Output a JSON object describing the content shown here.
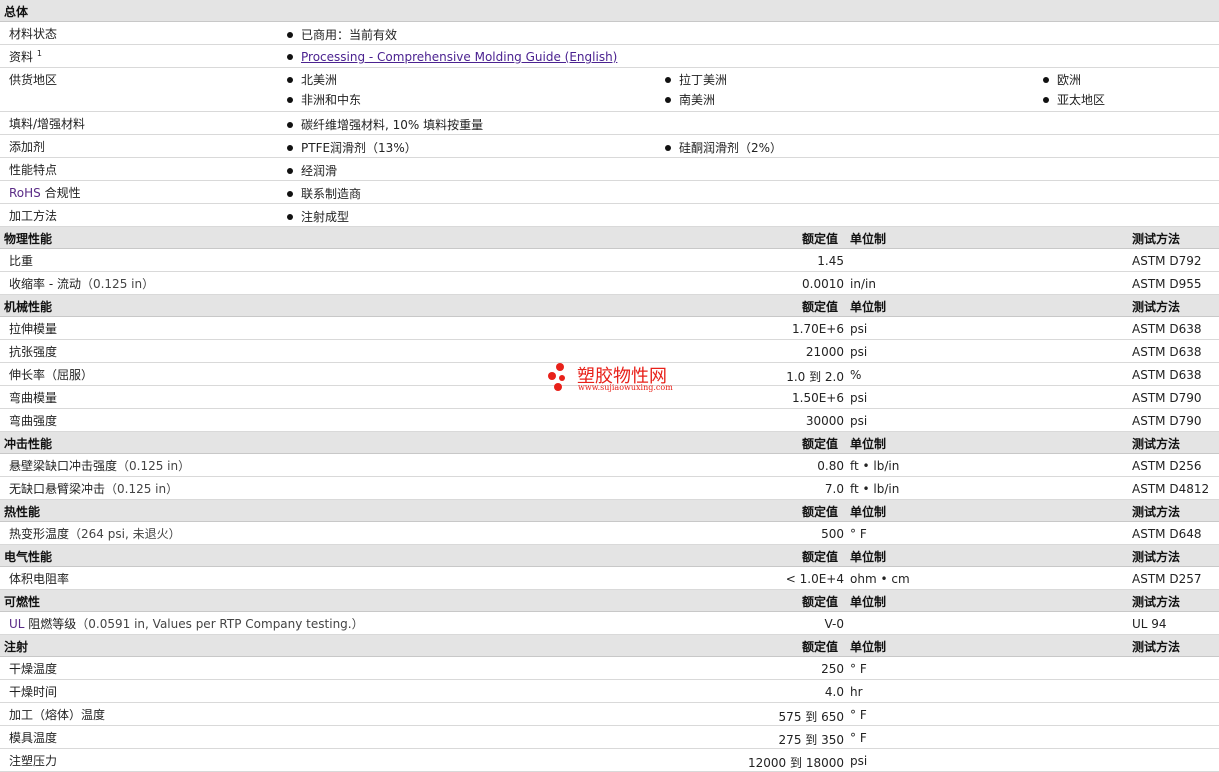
{
  "general": {
    "title": "总体",
    "rows": [
      {
        "label": "材料状态",
        "items": [
          "已商用：当前有效"
        ]
      },
      {
        "label": "资料",
        "sup": "1",
        "link": "Processing - Comprehensive Molding Guide (English)"
      },
      {
        "label": "供货地区",
        "items": [
          "北美洲",
          "拉丁美洲",
          "欧洲",
          "非洲和中东",
          "南美洲",
          "亚太地区"
        ]
      },
      {
        "label": "填料/增强材料",
        "items": [
          "碳纤维增强材料, 10% 填料按重量"
        ]
      },
      {
        "label": "添加剂",
        "items": [
          "PTFE润滑剂（13%）",
          "硅酮润滑剂（2%）"
        ]
      },
      {
        "label": "性能特点",
        "items": [
          "经润滑"
        ]
      },
      {
        "label": "RoHS 合规性",
        "label_colored": "RoHS",
        "label_rest": " 合规性",
        "items": [
          "联系制造商"
        ]
      },
      {
        "label": "加工方法",
        "items": [
          "注射成型"
        ]
      }
    ]
  },
  "col_headers": {
    "value": "额定值",
    "unit": "单位制",
    "method": "测试方法"
  },
  "sections": [
    {
      "title": "物理性能",
      "rows": [
        {
          "label": "比重",
          "cond": "",
          "value": "1.45",
          "unit": "",
          "method": "ASTM D792"
        },
        {
          "label": "收缩率  - 流动",
          "cond": "（0.125 in）",
          "value": "0.0010",
          "unit": "in/in",
          "method": "ASTM D955"
        }
      ]
    },
    {
      "title": "机械性能",
      "rows": [
        {
          "label": "拉伸模量",
          "cond": "",
          "value": "1.70E+6",
          "unit": "psi",
          "method": "ASTM D638"
        },
        {
          "label": "抗张强度",
          "cond": "",
          "value": "21000",
          "unit": "psi",
          "method": "ASTM D638"
        },
        {
          "label": "伸长率（屈服）",
          "cond": "",
          "value": "1.0 到  2.0",
          "unit": "%",
          "method": "ASTM D638"
        },
        {
          "label": "弯曲模量",
          "cond": "",
          "value": "1.50E+6",
          "unit": "psi",
          "method": "ASTM D790"
        },
        {
          "label": "弯曲强度",
          "cond": "",
          "value": "30000",
          "unit": "psi",
          "method": "ASTM D790"
        }
      ]
    },
    {
      "title": "冲击性能",
      "rows": [
        {
          "label": "悬壁梁缺口冲击强度",
          "cond": "（0.125 in）",
          "value": "0.80",
          "unit": "ft • lb/in",
          "method": "ASTM D256"
        },
        {
          "label": "无缺口悬臂梁冲击",
          "cond": "（0.125 in）",
          "value": "7.0",
          "unit": "ft • lb/in",
          "method": "ASTM D4812"
        }
      ]
    },
    {
      "title": "热性能",
      "rows": [
        {
          "label": "热变形温度",
          "cond": "（264 psi, 未退火）",
          "value": "500",
          "unit": "° F",
          "method": "ASTM D648"
        }
      ]
    },
    {
      "title": "电气性能",
      "rows": [
        {
          "label": "体积电阻率",
          "cond": "",
          "value": "< 1.0E+4",
          "unit": "ohm • cm",
          "method": "ASTM D257"
        }
      ]
    },
    {
      "title": "可燃性",
      "rows": [
        {
          "label": "UL 阻燃等级",
          "label_colored": "UL",
          "label_rest": " 阻燃等级",
          "cond": "（0.0591 in, Values per RTP Company testing.）",
          "value": "V-0",
          "unit": "",
          "method": "UL 94"
        }
      ]
    },
    {
      "title": "注射",
      "rows": [
        {
          "label": "干燥温度",
          "cond": "",
          "value": "250",
          "unit": "° F",
          "method": ""
        },
        {
          "label": "干燥时间",
          "cond": "",
          "value": "4.0",
          "unit": "hr",
          "method": ""
        },
        {
          "label": "加工（熔体）温度",
          "cond": "",
          "value": "575 到  650",
          "unit": "° F",
          "method": ""
        },
        {
          "label": "模具温度",
          "cond": "",
          "value": "275 到  350",
          "unit": "° F",
          "method": ""
        },
        {
          "label": "注塑压力",
          "cond": "",
          "value": "12000 到  18000",
          "unit": "psi",
          "method": ""
        }
      ]
    }
  ],
  "watermark": {
    "name": "塑胶物性网",
    "url": "www.sujiaowuxing.com"
  },
  "colors": {
    "header_bg": "#e4e4e4",
    "link": "#4b2290",
    "watermark": "#e8211a"
  }
}
